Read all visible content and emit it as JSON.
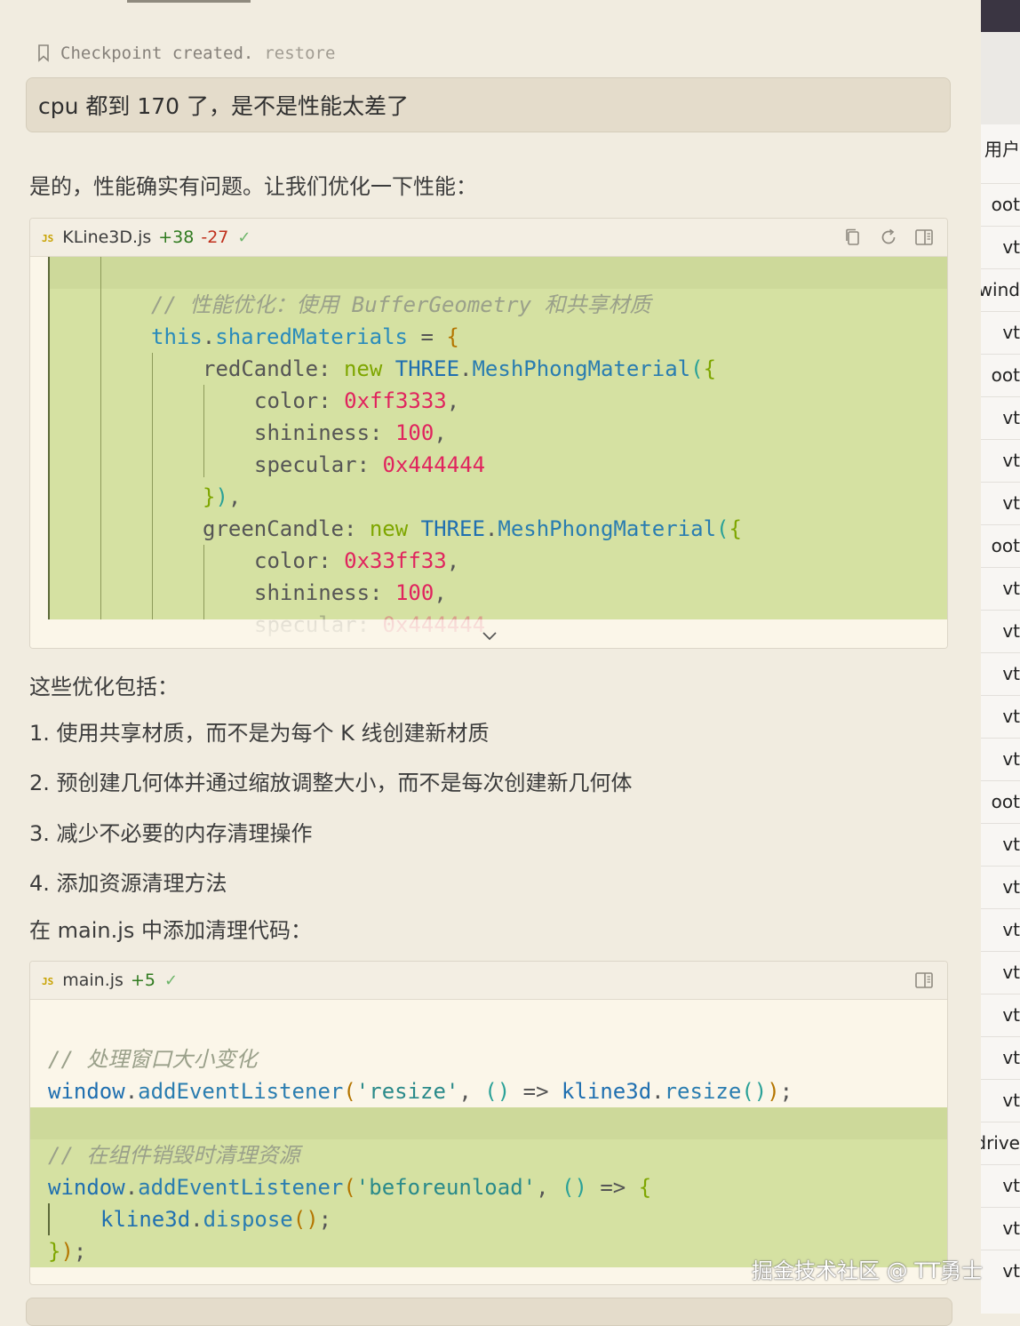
{
  "checkpoint": {
    "text": "Checkpoint created.",
    "restore": "restore"
  },
  "user_message": "cpu 都到 170 了，是不是性能太差了",
  "reply_intro": "是的，性能确实有问题。让我们优化一下性能：",
  "file1": {
    "badge": "JS",
    "name": "KLine3D.js",
    "added": "+38",
    "removed": "-27",
    "status": "✓",
    "icons": [
      "copy-icon",
      "refresh-icon",
      "panel-icon"
    ],
    "lines": {
      "comment": "// 性能优化：使用 BufferGeometry 和共享材质",
      "this": "this",
      "sharedMaterials": "sharedMaterials",
      "redCandle": "redCandle",
      "greenCandle": "greenCandle",
      "new": "new",
      "three": "THREE",
      "material": "MeshPhongMaterial",
      "color": "color",
      "shininess": "shininess",
      "specular": "specular",
      "red_color": "0xff3333",
      "green_color": "0x33ff33",
      "shininess_val": "100",
      "specular_val": "0x444444"
    }
  },
  "optim_heading": "这些优化包括：",
  "optimizations": [
    "1. 使用共享材质，而不是为每个 K 线创建新材质",
    "2. 预创建几何体并通过缩放调整大小，而不是每次创建新几何体",
    "3. 减少不必要的内存清理操作",
    "4. 添加资源清理方法"
  ],
  "main_intro": "在 main.js 中添加清理代码：",
  "file2": {
    "badge": "JS",
    "name": "main.js",
    "added": "+5",
    "status": "✓",
    "lines": {
      "comment1": "// 处理窗口大小变化",
      "window": "window",
      "addEventListener": "addEventListener",
      "resize_evt": "'resize'",
      "kline3d": "kline3d",
      "resize": "resize",
      "comment2": "// 在组件销毁时清理资源",
      "unload_evt": "'beforeunload'",
      "dispose": "dispose"
    }
  },
  "sidebar_items": [
    "用户",
    "oot",
    "vt",
    "wind",
    "vt",
    "oot",
    "vt",
    "vt",
    "vt",
    "oot",
    "vt",
    "vt",
    "vt",
    "vt",
    "vt",
    "oot",
    "vt",
    "vt",
    "vt",
    "vt",
    "vt",
    "vt",
    "vt",
    "drive",
    "vt",
    "vt",
    "vt"
  ],
  "watermark": "掘金技术社区 @ TT勇士"
}
